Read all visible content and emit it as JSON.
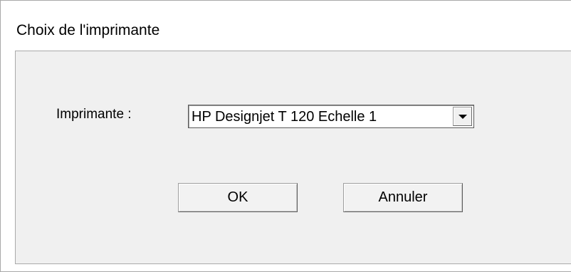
{
  "window": {
    "title": "Choix de l'imprimante"
  },
  "printer": {
    "label": "Imprimante :",
    "selected": "HP Designjet T 120 Echelle 1",
    "dropdown_icon": "chevron-down-icon"
  },
  "buttons": {
    "ok_label": "OK",
    "cancel_label": "Annuler"
  },
  "colors": {
    "client_background": "#f0f0f0",
    "title_background": "#ffffff",
    "button_face": "#f2f2f2"
  }
}
